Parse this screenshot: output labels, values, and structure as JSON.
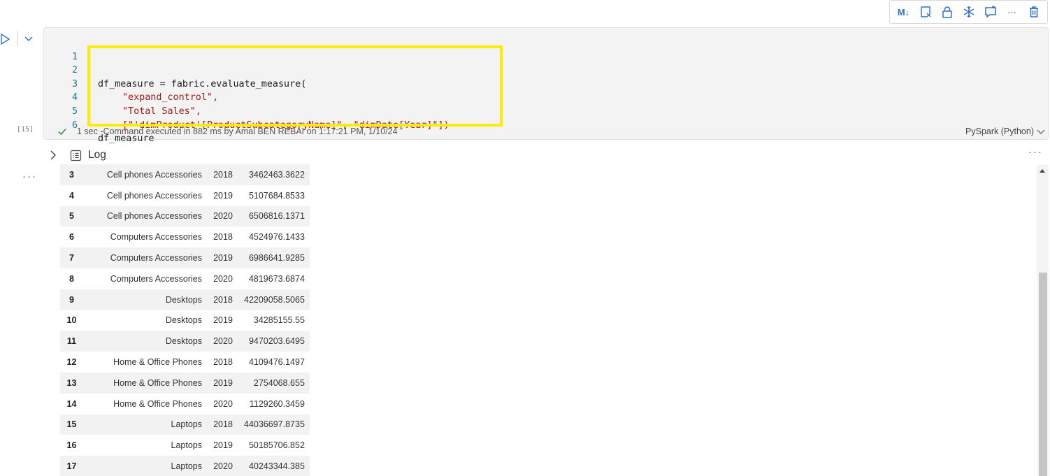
{
  "toolbar": {
    "markdown_label": "M↓",
    "buttons": [
      "markdown-icon",
      "clear-output-icon",
      "lock-icon",
      "freeze-icon",
      "comment-icon",
      "more-icon",
      "delete-icon"
    ],
    "more_label": "···"
  },
  "cell": {
    "execution_count": "[15]",
    "lines": [
      {
        "n": "1",
        "text": ""
      },
      {
        "n": "2",
        "text": "df_measure = fabric.evaluate_measure("
      },
      {
        "n": "3",
        "text": "\"expand_control\","
      },
      {
        "n": "4",
        "text": "\"Total Sales\","
      },
      {
        "n": "5",
        "text": "[\"'dimProduct'[ProductSubcategoryName]\", \"dimDate[Year]\"])"
      },
      {
        "n": "6",
        "text": "df_measure"
      }
    ],
    "status": "1 sec -Command executed in 882 ms by Amal BEN REBAI on 1:17:21 PM, 1/10/24",
    "language": "PySpark (Python)",
    "highlight_color": "#ffeb00",
    "more_label": "···"
  },
  "output": {
    "log_label": "Log",
    "more_label": "···",
    "rows": [
      {
        "idx": "3",
        "name": "Cell phones Accessories",
        "year": "2018",
        "value": "3462463.3622"
      },
      {
        "idx": "4",
        "name": "Cell phones Accessories",
        "year": "2019",
        "value": "5107684.8533"
      },
      {
        "idx": "5",
        "name": "Cell phones Accessories",
        "year": "2020",
        "value": "6506816.1371"
      },
      {
        "idx": "6",
        "name": "Computers Accessories",
        "year": "2018",
        "value": "4524976.1433"
      },
      {
        "idx": "7",
        "name": "Computers Accessories",
        "year": "2019",
        "value": "6986641.9285"
      },
      {
        "idx": "8",
        "name": "Computers Accessories",
        "year": "2020",
        "value": "4819673.6874"
      },
      {
        "idx": "9",
        "name": "Desktops",
        "year": "2018",
        "value": "42209058.5065"
      },
      {
        "idx": "10",
        "name": "Desktops",
        "year": "2019",
        "value": "34285155.55"
      },
      {
        "idx": "11",
        "name": "Desktops",
        "year": "2020",
        "value": "9470203.6495"
      },
      {
        "idx": "12",
        "name": "Home & Office Phones",
        "year": "2018",
        "value": "4109476.1497"
      },
      {
        "idx": "13",
        "name": "Home & Office Phones",
        "year": "2019",
        "value": "2754068.655"
      },
      {
        "idx": "14",
        "name": "Home & Office Phones",
        "year": "2020",
        "value": "1129260.3459"
      },
      {
        "idx": "15",
        "name": "Laptops",
        "year": "2018",
        "value": "44036697.8735"
      },
      {
        "idx": "16",
        "name": "Laptops",
        "year": "2019",
        "value": "50185706.852"
      },
      {
        "idx": "17",
        "name": "Laptops",
        "year": "2020",
        "value": "40243344.385"
      }
    ]
  }
}
